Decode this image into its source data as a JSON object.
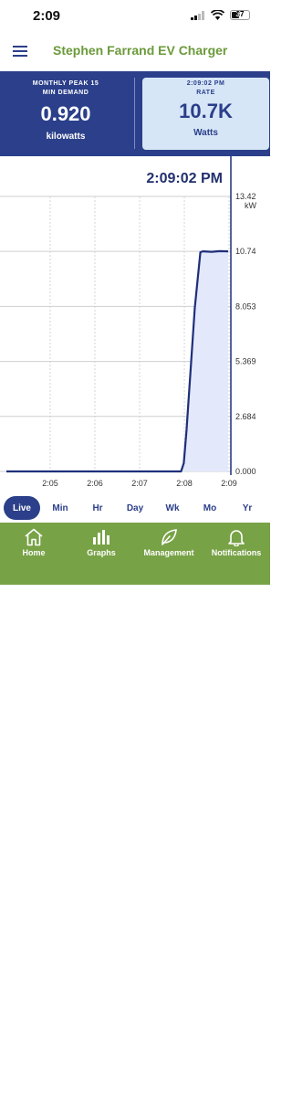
{
  "status_bar": {
    "time": "2:09",
    "battery": "37"
  },
  "header": {
    "title": "Stephen Farrand EV Charger",
    "menu_icon": "hamburger-menu-icon"
  },
  "stats": {
    "left": {
      "caption_line1": "MONTHLY PEAK 15",
      "caption_line2": "MIN DEMAND",
      "value": "0.920",
      "unit": "kilowatts"
    },
    "right": {
      "caption_line1": "2:09:02 PM",
      "caption_line2": "RATE",
      "value": "10.7K",
      "unit": "Watts"
    }
  },
  "chart": {
    "current_time": "2:09:02 PM"
  },
  "chart_data": {
    "type": "area",
    "x_ticks": [
      "2:05",
      "2:06",
      "2:07",
      "2:08",
      "2:09"
    ],
    "y_ticks": [
      "0.000",
      "2.684",
      "5.369",
      "8.053",
      "10.74",
      "13.42"
    ],
    "y_unit": "kW",
    "ylim": [
      0,
      13.42
    ],
    "x": [
      0,
      3.15,
      3.2,
      3.25,
      3.4,
      3.5,
      3.55,
      3.7,
      3.85,
      4.0
    ],
    "values": [
      0.0,
      0.0,
      0.4,
      2.0,
      8.0,
      10.7,
      10.74,
      10.72,
      10.75,
      10.74
    ],
    "grid": true,
    "colors": {
      "line": "#1e2f7a",
      "fill": "#e4e8fb"
    }
  },
  "ranges": {
    "items": [
      "Live",
      "Min",
      "Hr",
      "Day",
      "Wk",
      "Mo",
      "Yr"
    ],
    "active": "Live"
  },
  "nav": {
    "items": [
      {
        "label": "Home",
        "icon": "home-icon"
      },
      {
        "label": "Graphs",
        "icon": "bar-chart-icon"
      },
      {
        "label": "Management",
        "icon": "leaf-icon"
      },
      {
        "label": "Notifications",
        "icon": "bell-icon"
      }
    ]
  }
}
